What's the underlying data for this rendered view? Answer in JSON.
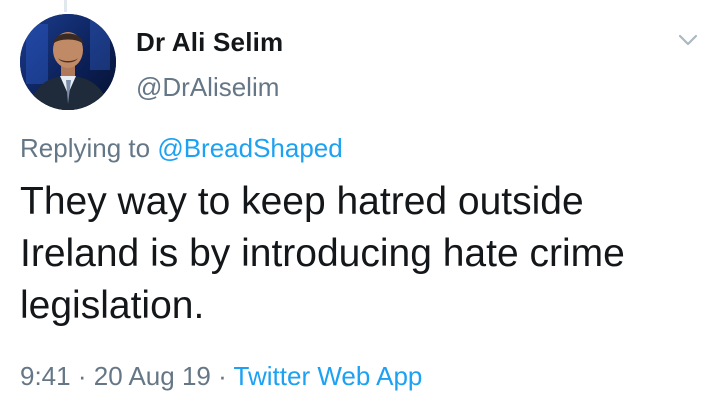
{
  "author": {
    "name": "Dr Ali Selim",
    "handle": "@DrAliselim"
  },
  "reply": {
    "prefix": "Replying to",
    "mention": "@BreadShaped"
  },
  "tweet": {
    "text": "They way to keep hatred outside Ireland is by introducing hate crime legislation."
  },
  "meta": {
    "time": "9:41",
    "sep1": "·",
    "date": "20 Aug 19",
    "sep2": "·",
    "source": "Twitter Web App"
  },
  "icons": {
    "menu": "chevron-down-icon",
    "avatar": "profile-photo"
  },
  "colors": {
    "text": "#14171a",
    "secondary": "#657786",
    "link": "#1da1f2"
  }
}
